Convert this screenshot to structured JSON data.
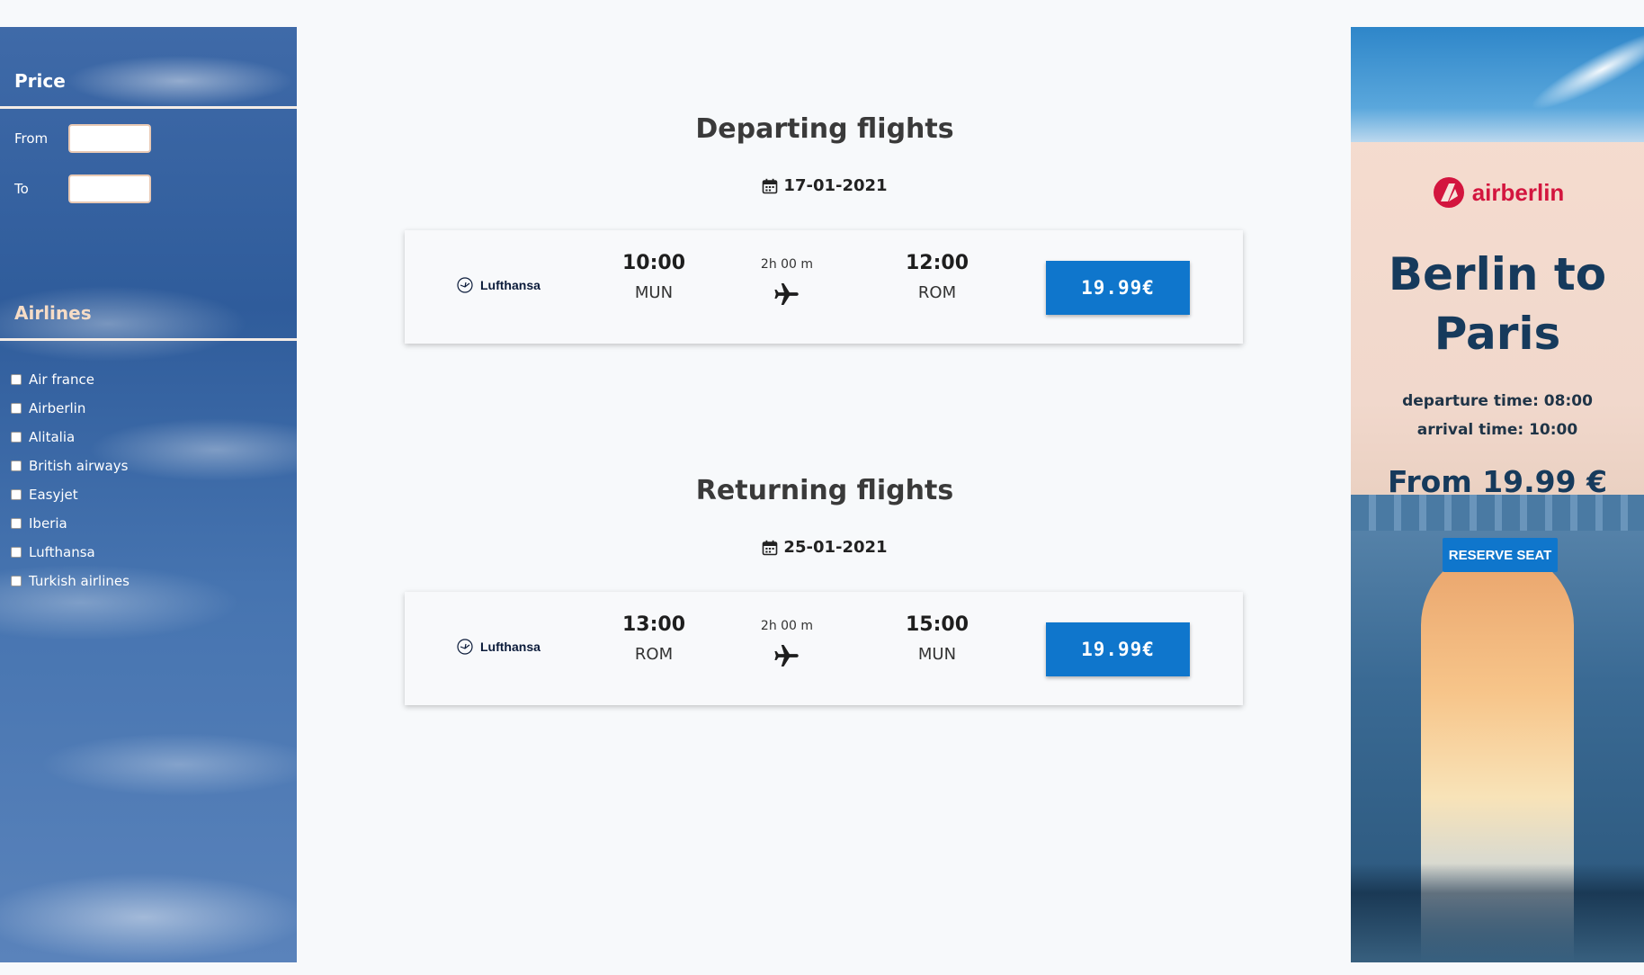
{
  "sidebar": {
    "price_heading": "Price",
    "from_label": "From",
    "to_label": "To",
    "from_value": "",
    "to_value": "",
    "airlines_heading": "Airlines",
    "airlines": [
      {
        "label": "Air france",
        "checked": false
      },
      {
        "label": "Airberlin",
        "checked": false
      },
      {
        "label": "Alitalia",
        "checked": false
      },
      {
        "label": "British airways",
        "checked": false
      },
      {
        "label": "Easyjet",
        "checked": false
      },
      {
        "label": "Iberia",
        "checked": false
      },
      {
        "label": "Lufthansa",
        "checked": false
      },
      {
        "label": "Turkish airlines",
        "checked": false
      }
    ]
  },
  "departing": {
    "title": "Departing flights",
    "date": "17-01-2021",
    "flight": {
      "airline": "Lufthansa",
      "dep_time": "10:00",
      "dep_code": "MUN",
      "duration": "2h 00 m",
      "arr_time": "12:00",
      "arr_code": "ROM",
      "price": "19.99€"
    }
  },
  "returning": {
    "title": "Returning flights",
    "date": "25-01-2021",
    "flight": {
      "airline": "Lufthansa",
      "dep_time": "13:00",
      "dep_code": "ROM",
      "duration": "2h 00 m",
      "arr_time": "15:00",
      "arr_code": "MUN",
      "price": "19.99€"
    }
  },
  "ad": {
    "brand": "airberlin",
    "title": "Berlin to Paris",
    "departure": "departure time: 08:00",
    "arrival": "arrival time: 10:00",
    "price": "From 19.99 €",
    "button": "RESERVE SEAT"
  },
  "colors": {
    "accent": "#0f76cc",
    "brand_red": "#d3153e",
    "ad_title": "#163a5c"
  },
  "icons": [
    "calendar-icon",
    "lufthansa-crane-icon",
    "airplane-icon",
    "airberlin-logo-icon"
  ]
}
